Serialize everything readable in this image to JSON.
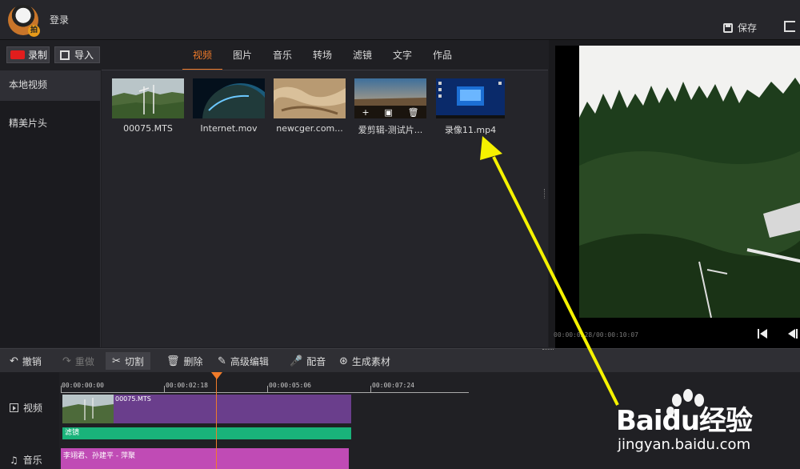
{
  "header": {
    "login": "登录",
    "save": "保存",
    "logo_badge": "拍"
  },
  "library": {
    "record": "录制",
    "import": "导入",
    "tabs": [
      "视频",
      "图片",
      "音乐",
      "转场",
      "滤镜",
      "文字",
      "作品"
    ],
    "active_tab": "视频"
  },
  "sidebar": {
    "items": [
      "本地视频",
      "精美片头"
    ],
    "active": "本地视频"
  },
  "media": [
    {
      "name": "00075.MTS"
    },
    {
      "name": "Internet.mov"
    },
    {
      "name": "newcger.com..."
    },
    {
      "name": "爱剪辑-测试片..."
    },
    {
      "name": "录像11.mp4"
    }
  ],
  "hover_actions": [
    "+",
    "▣",
    "🗑"
  ],
  "preview": {
    "time": "00:00:0…28/00:00:10:07"
  },
  "toolbar": {
    "undo": "撤销",
    "redo": "重做",
    "cut": "切割",
    "delete": "删除",
    "advanced": "高级编辑",
    "dub": "配音",
    "generate": "生成素材"
  },
  "timeline": {
    "ticks": [
      "00:00:00:00",
      "00:00:02:18",
      "00:00:05:06",
      "00:00:07:24"
    ],
    "tracks": {
      "video": "视频",
      "music": "音乐"
    },
    "video_clip": "00075.MTS",
    "filter_clip": "滤镜",
    "music_clip": "李翊君、孙建平 - 萍聚"
  },
  "watermark": {
    "brand": "Baidu经验",
    "url": "jingyan.baidu.com"
  },
  "colors": {
    "accent": "#f07b2a",
    "video_clip": "#6a3e8c",
    "filter_clip": "#19b37a",
    "music_clip": "#c04bb5",
    "arrow": "#f5f200"
  }
}
